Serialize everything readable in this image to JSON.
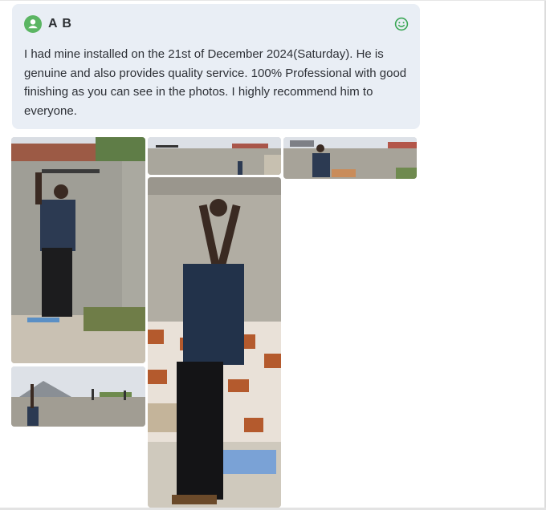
{
  "review": {
    "author": "A B",
    "avatar_icon": "user-icon",
    "mood_icon": "smiley-icon",
    "text": "I had mine installed on the 21st of December 2024(Saturday). He is genuine and also provides quality service. 100% Professional with good finishing as you can see in the photos. I highly recommend him to everyone."
  },
  "photos": [
    {
      "subject": "man installing fence wire on wall"
    },
    {
      "subject": "wall top with fence brackets"
    },
    {
      "subject": "man standing at wall top"
    },
    {
      "subject": "man drilling wall with angle grinder"
    },
    {
      "subject": "man on wall with fence posts"
    }
  ],
  "colors": {
    "bubble": "#e9eef5",
    "accent": "#5bb563",
    "text": "#2d3036"
  }
}
